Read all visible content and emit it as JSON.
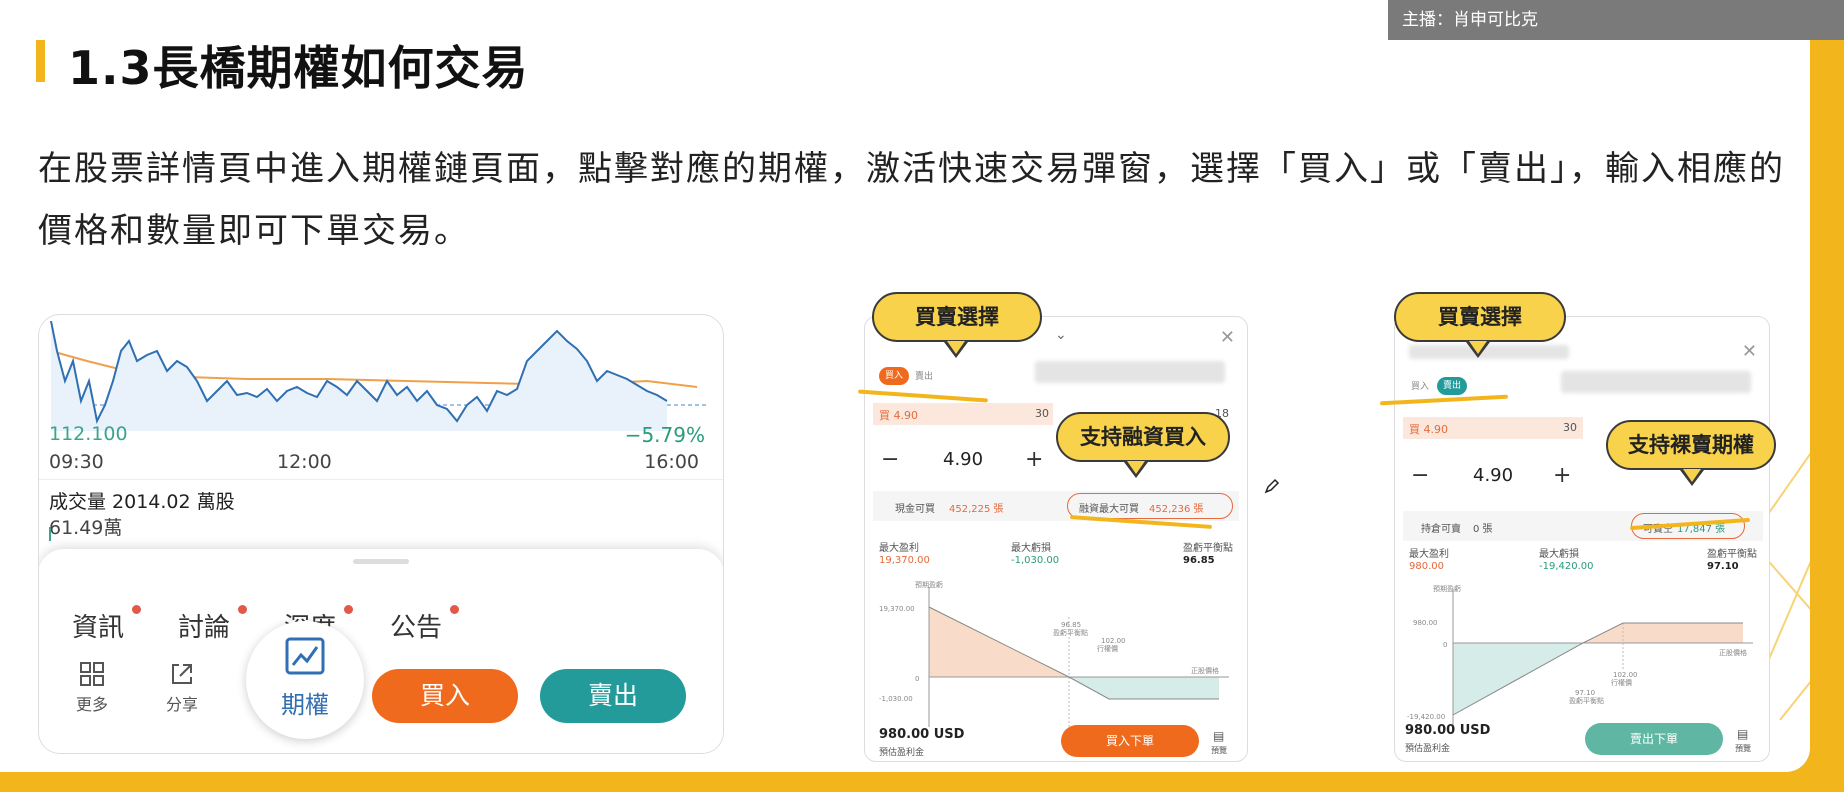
{
  "header": {
    "host": "主播：肖申可比克"
  },
  "slide": {
    "title": "1.3長橋期權如何交易",
    "description": "在股票詳情頁中進入期權鏈頁面，點擊對應的期權，激活快速交易彈窗，選擇「買入」或「賣出」，輸入相應的價格和數量即可下單交易。"
  },
  "colors": {
    "accent": "#f2b51c",
    "buy": "#f06a1e",
    "sell": "#239b9b",
    "chart_line": "#2f6fb2"
  },
  "chart": {
    "low_price": "112.100",
    "change_percent": "−5.79%",
    "time_start": "09:30",
    "time_mid": "12:00",
    "time_end": "16:00",
    "volume_text": "成交量 2014.02 萬股",
    "volume_value": "61.49萬"
  },
  "sheet": {
    "tabs": [
      "資訊",
      "討論",
      "深度",
      "公告"
    ],
    "more_label": "更多",
    "share_label": "分享",
    "options_label": "期權",
    "buy_label": "買入",
    "sell_label": "賣出"
  },
  "annotations": {
    "buy_sell_choice": "買賣選擇",
    "margin_buy": "支持融資買入",
    "naked_sell": "支持裸賣期權"
  },
  "popup_buy": {
    "buy_toggle": "買入",
    "sell_toggle": "賣出",
    "bid_price": "買 4.90",
    "bid_size": "30",
    "ask_size": "18",
    "price": "4.90",
    "cash_label": "現金可買",
    "cash_value": "452,225 張",
    "margin_label": "融資最大可買",
    "margin_value": "452,236 張",
    "max_profit_label": "最大盈利",
    "max_profit_value": "19,370.00",
    "max_loss_label": "最大虧損",
    "max_loss_value": "-1,030.00",
    "breakeven_label": "盈虧平衡點",
    "breakeven_value": "96.85",
    "diagram_ylabel": "預期盈虧",
    "diagram_ymax": "19,370.00",
    "diagram_zero": "0",
    "diagram_ymin": "-1,030.00",
    "diagram_breakeven_label": "盈虧平衡點",
    "diagram_strike_value": "102.00",
    "diagram_strike_label": "行權價",
    "diagram_xlabel": "正股價格",
    "expected_profit": "980.00 USD",
    "expected_label": "預估盈利金",
    "order_label": "買入下單",
    "preview_label": "預覽"
  },
  "popup_sell": {
    "buy_toggle": "買入",
    "sell_toggle": "賣出",
    "bid_price": "買 4.90",
    "bid_size": "30",
    "price": "4.90",
    "position_label": "持倉可賣",
    "position_value": "0 張",
    "short_label": "可賣空",
    "short_value": "17,847 張",
    "max_profit_label": "最大盈利",
    "max_profit_value": "980.00",
    "max_loss_label": "最大虧損",
    "max_loss_value": "-19,420.00",
    "breakeven_label": "盈虧平衡點",
    "breakeven_value": "97.10",
    "diagram_ylabel": "預期盈虧",
    "diagram_ymax": "980.00",
    "diagram_zero": "0",
    "diagram_ymin": "-19,420.00",
    "diagram_strike_value": "102.00",
    "diagram_strike_label": "行權價",
    "diagram_breakeven_label": "盈虧平衡點",
    "diagram_xlabel": "正股價格",
    "expected_profit": "980.00 USD",
    "expected_label": "預估盈利金",
    "order_label": "賣出下單",
    "preview_label": "預覽"
  }
}
